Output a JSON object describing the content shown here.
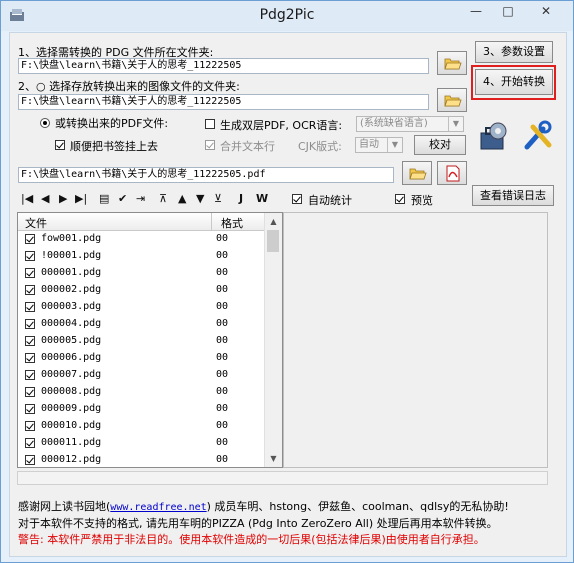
{
  "window": {
    "title": "Pdg2Pic",
    "controls": {
      "minimize": "—",
      "maximize": "□",
      "close": "✕"
    }
  },
  "steps": {
    "step1_label": "1、选择需转换的 PDG 文件所在文件夹:",
    "step1_path": "F:\\快盘\\learn\\书籍\\关于人的思考_11222505",
    "step2_label": "2、○ 选择存放转换出来的图像文件的文件夹:",
    "step2_path": "F:\\快盘\\learn\\书籍\\关于人的思考_11222505",
    "pdf_radio_label": "或转换出来的PDF文件:",
    "double_layer_label": "生成双层PDF, OCR语言:",
    "ocr_language": "(系统缺省语言)",
    "bookmark_label": "顺便把书签挂上去",
    "merge_text_label": "合并文本行",
    "cjk_label": "CJK版式:",
    "cjk_value": "自动",
    "verify_button": "校对",
    "pdf_path": "F:\\快盘\\learn\\书籍\\关于人的思考_11222505.pdf"
  },
  "buttons": {
    "step3": "3、参数设置",
    "step4": "4、开始转换",
    "error_log": "查看错误日志"
  },
  "toolbar": {
    "icons": [
      "|◀",
      "◀",
      "▶",
      "▶|",
      "▤",
      "✔",
      "⇥",
      "⊼",
      "▲",
      "▼",
      "⊻",
      "J",
      "W"
    ]
  },
  "options": {
    "auto_stats": "自动统计",
    "preview": "预览"
  },
  "file_list": {
    "col_file": "文件",
    "col_format": "格式",
    "rows": [
      {
        "name": "fow001.pdg",
        "format": "00"
      },
      {
        "name": "!00001.pdg",
        "format": "00"
      },
      {
        "name": "000001.pdg",
        "format": "00"
      },
      {
        "name": "000002.pdg",
        "format": "00"
      },
      {
        "name": "000003.pdg",
        "format": "00"
      },
      {
        "name": "000004.pdg",
        "format": "00"
      },
      {
        "name": "000005.pdg",
        "format": "00"
      },
      {
        "name": "000006.pdg",
        "format": "00"
      },
      {
        "name": "000007.pdg",
        "format": "00"
      },
      {
        "name": "000008.pdg",
        "format": "00"
      },
      {
        "name": "000009.pdg",
        "format": "00"
      },
      {
        "name": "000010.pdg",
        "format": "00"
      },
      {
        "name": "000011.pdg",
        "format": "00"
      },
      {
        "name": "000012.pdg",
        "format": "00"
      }
    ]
  },
  "footer": {
    "line1_pre": "感谢网上读书园地(",
    "line1_link": "www.readfree.net",
    "line1_post": ") 成员车明、hstong、伊兹鱼、coolman、qdlsy的无私协助!",
    "line2": "对于本软件不支持的格式, 请先用车明的PIZZA (Pdg Into ZeroZero All) 处理后再用本软件转换。",
    "line3": "警告: 本软件严禁用于非法目的。使用本软件造成的一切后果(包括法律后果)由使用者自行承担。"
  },
  "colors": {
    "warning": "#e00000",
    "highlight": "#e11e1e",
    "link": "#0000cc"
  }
}
